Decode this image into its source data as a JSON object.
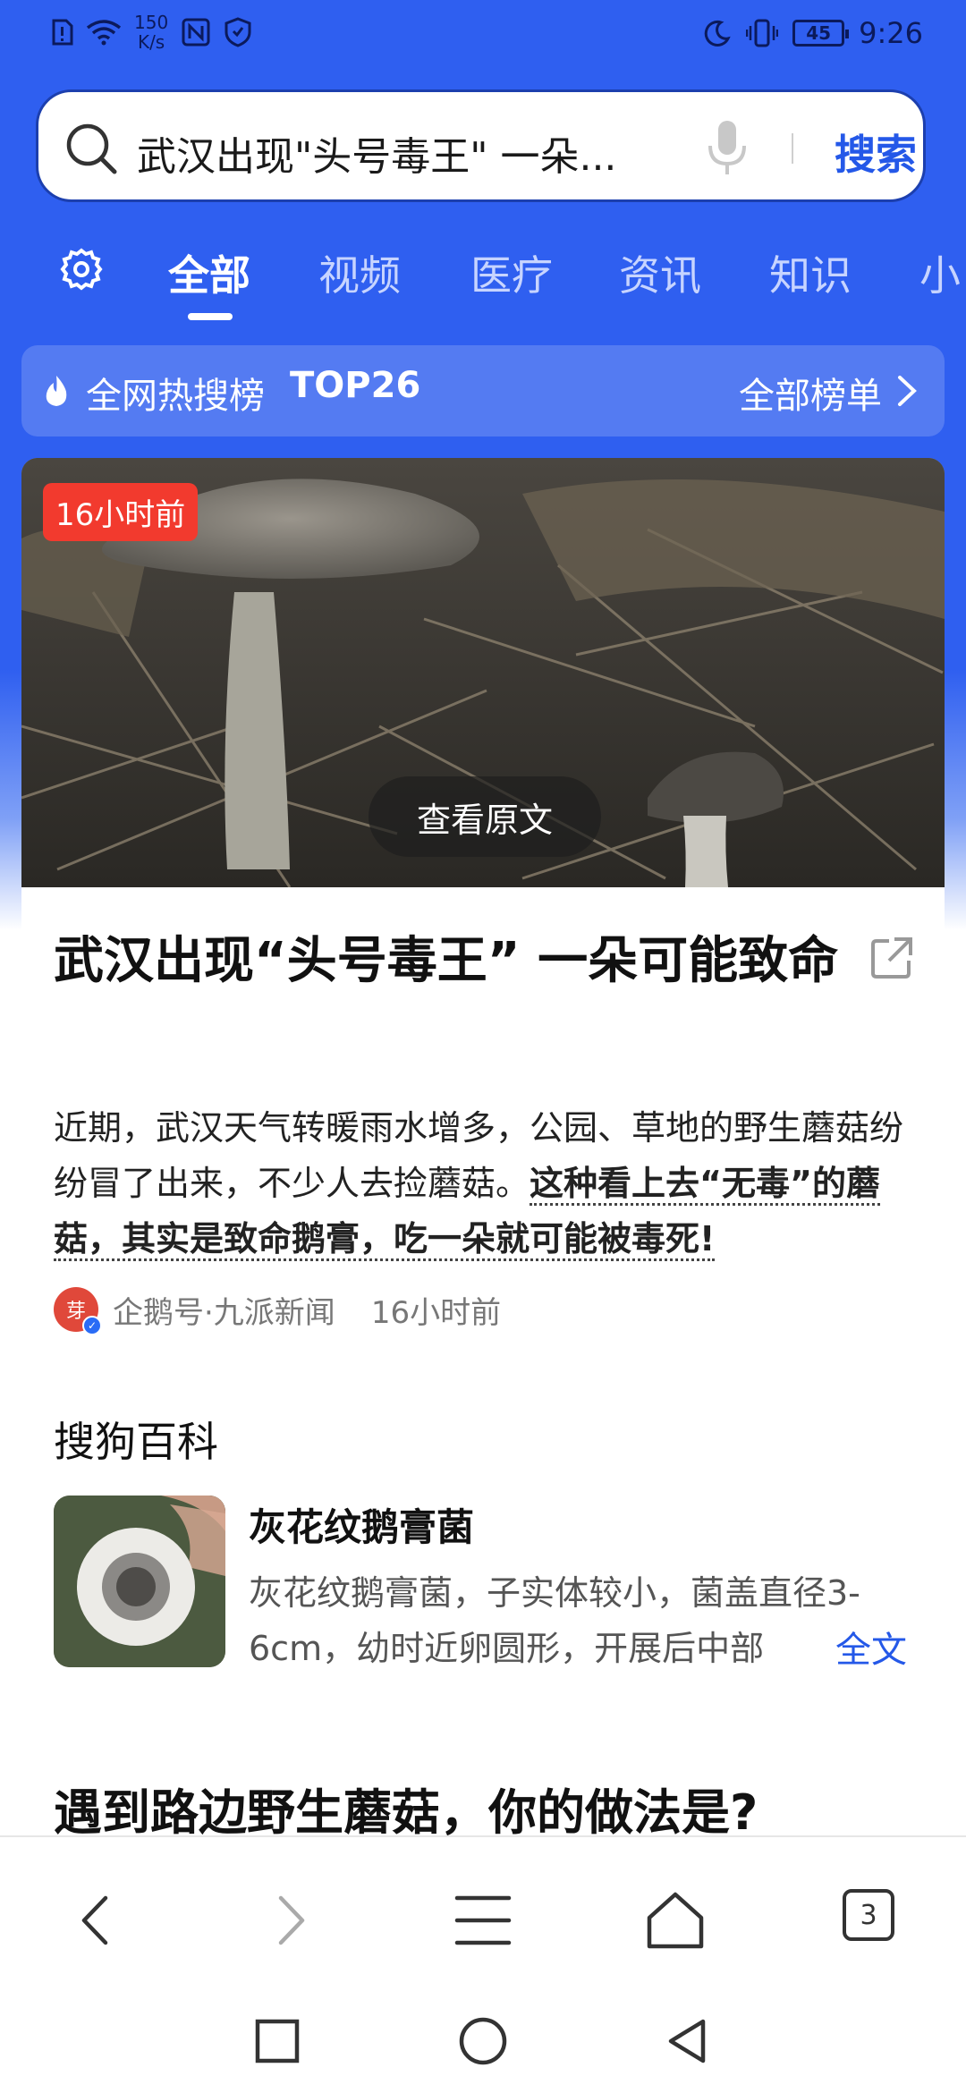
{
  "status_bar": {
    "net_speed_value": "150",
    "net_speed_unit": "K/s",
    "battery": "45",
    "time": "9:26"
  },
  "search": {
    "query": "武汉出现\"头号毒王\" 一朵...",
    "button_label": "搜索"
  },
  "tabs": {
    "items": [
      {
        "label": "全部"
      },
      {
        "label": "视频"
      },
      {
        "label": "医疗"
      },
      {
        "label": "资讯"
      },
      {
        "label": "知识"
      },
      {
        "label": "小"
      }
    ]
  },
  "hot_bar": {
    "title": "全网热搜榜",
    "rank": "TOP26",
    "all_label": "全部榜单"
  },
  "article": {
    "badge": "16小时前",
    "view_original": "查看原文",
    "title": "武汉出现“头号毒王” 一朵可能致命",
    "body_plain": "近期，武汉天气转暖雨水增多，公园、草地的野生蘑菇纷纷冒了出来，不少人去捡蘑菇。",
    "body_highlight": "这种看上去“无毒”的蘑菇，其实是致命鹅膏，吃一朵就可能被毒死!",
    "source_avatar_text": "芽",
    "source_name": "企鹅号·九派新闻",
    "source_time": "16小时前"
  },
  "baike": {
    "section_title": "搜狗百科",
    "name": "灰花纹鹅膏菌",
    "description": "灰花纹鹅膏菌，子实体较小，菌盖直径3-6cm，幼时近卵圆形，开展后中部",
    "more_label": "全文"
  },
  "question": {
    "title": "遇到路边野生蘑菇，你的做法是?"
  },
  "browser_nav": {
    "tab_count": "3"
  },
  "colors": {
    "brand_blue": "#2f5ff0",
    "link_blue": "#2458e8",
    "badge_red": "#f23a2e"
  }
}
